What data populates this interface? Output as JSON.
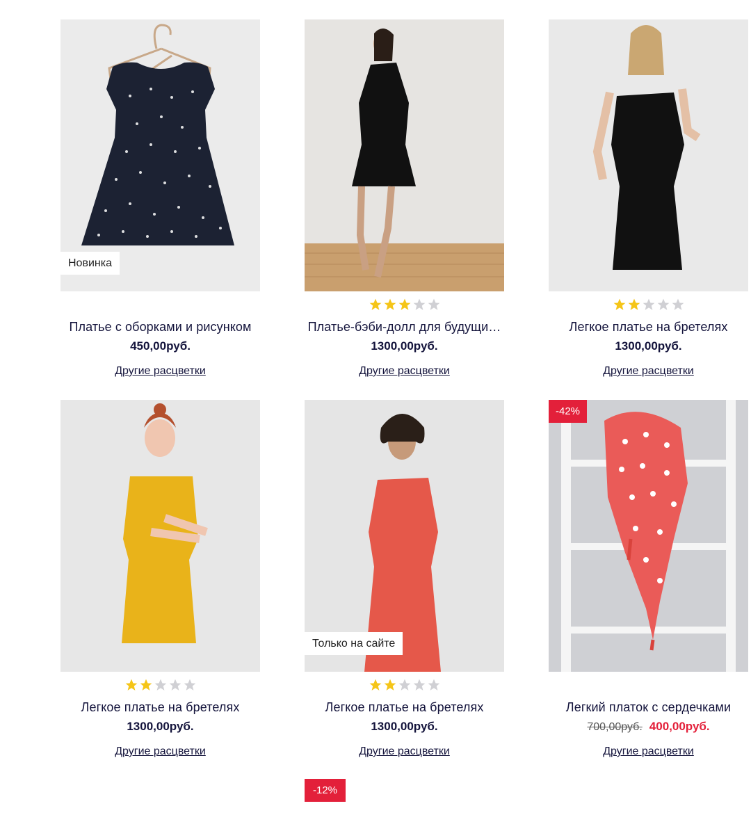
{
  "colors": {
    "sale": "#e3203a",
    "text": "#14143c",
    "star_on": "#f5c518",
    "star_off": "#d0d0d4"
  },
  "products": [
    {
      "title": "Платье с оборками и рисунком",
      "price": "450,00руб.",
      "colors_link": "Другие расцветки",
      "badge": "Новинка",
      "rating": 0,
      "image": "navy-print-dress"
    },
    {
      "title": "Платье-бэби-долл для будущи…",
      "price": "1300,00руб.",
      "colors_link": "Другие расцветки",
      "rating": 3,
      "image": "black-maternity-dress"
    },
    {
      "title": "Легкое платье на бретелях",
      "price": "1300,00руб.",
      "colors_link": "Другие расцветки",
      "rating": 2,
      "image": "black-strap-dress"
    },
    {
      "title": "Легкое платье на бретелях",
      "price": "1300,00руб.",
      "colors_link": "Другие расцветки",
      "rating": 2,
      "image": "yellow-strap-dress"
    },
    {
      "title": "Легкое платье на бретелях",
      "price": "1300,00руб.",
      "colors_link": "Другие расцветки",
      "badge": "Только на сайте",
      "rating": 2,
      "image": "red-strap-dress"
    },
    {
      "title": "Легкий платок с сердечками",
      "price_old": "700,00руб.",
      "price": "400,00руб.",
      "colors_link": "Другие расцветки",
      "sale_badge": "-42%",
      "rating": 0,
      "image": "heart-scarf"
    }
  ],
  "next_row_badge": "-12%"
}
